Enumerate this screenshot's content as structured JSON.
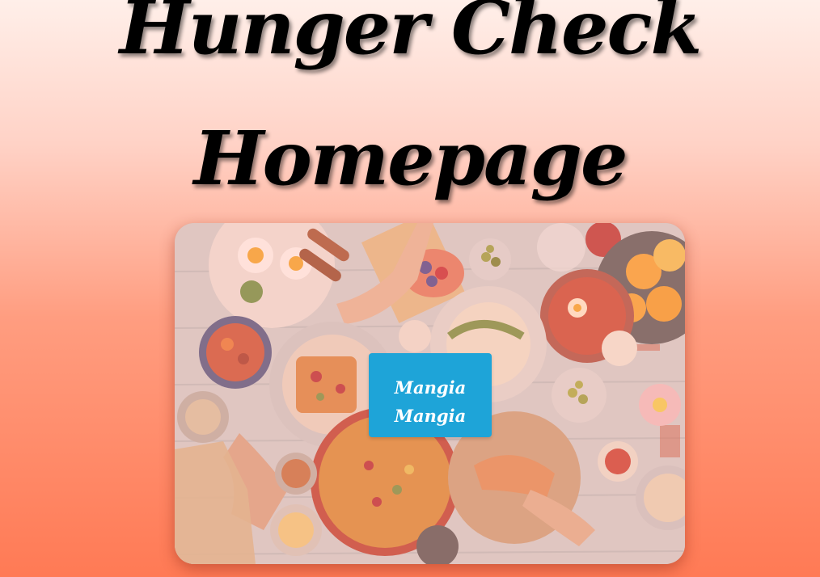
{
  "page": {
    "title_line1": "Hunger Check",
    "title_line2": "Homepage"
  },
  "hero": {
    "image_description_icon": "food-table-photo",
    "button_label": "Mangia Mangia"
  },
  "colors": {
    "background_top": "#ffefe9",
    "background_bottom": "#ff7a55",
    "button": "#1ea4d8",
    "title_text": "#000000",
    "button_text": "#ffffff"
  }
}
